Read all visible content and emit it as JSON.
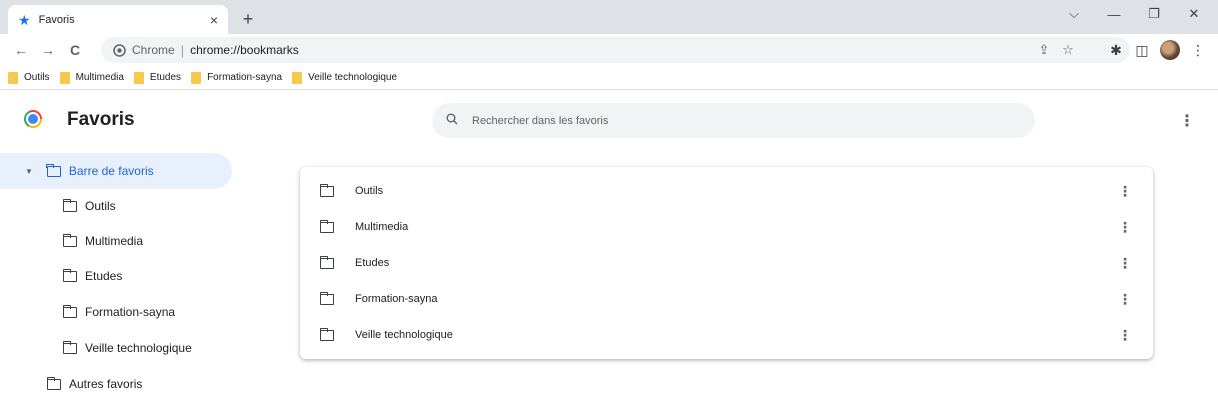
{
  "tab": {
    "title": "Favoris",
    "close_glyph": "×",
    "icon": "star-icon"
  },
  "newtab_glyph": "+",
  "window": {
    "dropdown": "⌵",
    "minimize": "—",
    "restore": "❐",
    "close": "✕"
  },
  "nav": {
    "back": "←",
    "forward": "→",
    "reload": "C"
  },
  "omnibox": {
    "chip": "Chrome",
    "separator": "|",
    "url": "chrome://bookmarks"
  },
  "toolbar_icons": {
    "share": "⇪",
    "star": "☆",
    "extensions": "✱",
    "sidepanel": "◫",
    "menu": "⋮"
  },
  "bookmarks_bar": [
    {
      "label": "Outils"
    },
    {
      "label": "Multimedia"
    },
    {
      "label": "Etudes"
    },
    {
      "label": "Formation-sayna"
    },
    {
      "label": "Veille technologique"
    }
  ],
  "header": {
    "title": "Favoris",
    "search_placeholder": "Rechercher dans les favoris",
    "search_glyph": "⌕",
    "menu_glyph": "⋮"
  },
  "sidebar": {
    "root": {
      "label": "Barre de favoris",
      "arrow": "▼"
    },
    "children": [
      {
        "label": "Outils"
      },
      {
        "label": "Multimedia"
      },
      {
        "label": "Etudes"
      },
      {
        "label": "Formation-sayna"
      },
      {
        "label": "Veille technologique"
      }
    ],
    "other": {
      "label": "Autres favoris"
    }
  },
  "list": {
    "menu_glyph": "⋮",
    "items": [
      {
        "label": "Outils"
      },
      {
        "label": "Multimedia"
      },
      {
        "label": "Etudes"
      },
      {
        "label": "Formation-sayna"
      },
      {
        "label": "Veille technologique"
      }
    ]
  },
  "colors": {
    "accent": "#1967d2",
    "selected_bg": "#e8f0fe",
    "tabstrip": "#dee1e6",
    "folder": "#f7c94b"
  }
}
